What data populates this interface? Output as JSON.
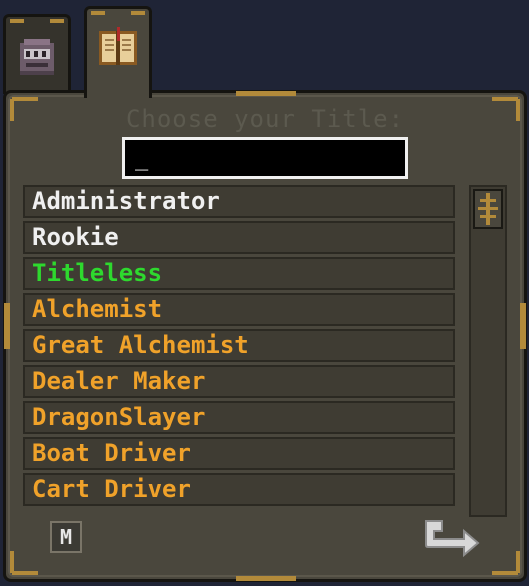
{
  "tabs": [
    {
      "icon": "creature-head-icon"
    },
    {
      "icon": "book-icon"
    }
  ],
  "dialog": {
    "title": "Choose your Title:",
    "input_value": "_"
  },
  "titles": [
    {
      "label": "Administrator",
      "color": "#f0f0f0"
    },
    {
      "label": "Rookie",
      "color": "#f0f0f0"
    },
    {
      "label": "Titleless",
      "color": "#2ed92e"
    },
    {
      "label": "Alchemist",
      "color": "#f0a22a"
    },
    {
      "label": "Great Alchemist",
      "color": "#f0a22a"
    },
    {
      "label": "Dealer Maker",
      "color": "#f0a22a"
    },
    {
      "label": "DragonSlayer",
      "color": "#f0a22a"
    },
    {
      "label": "Boat Driver",
      "color": "#f0a22a"
    },
    {
      "label": "Cart Driver",
      "color": "#f0a22a"
    }
  ],
  "buttons": {
    "m_label": "M",
    "back_icon": "back-arrow-icon"
  },
  "colors": {
    "accent_gold": "#b28a3a",
    "panel": "#4a473d",
    "background": "#1f2436"
  }
}
